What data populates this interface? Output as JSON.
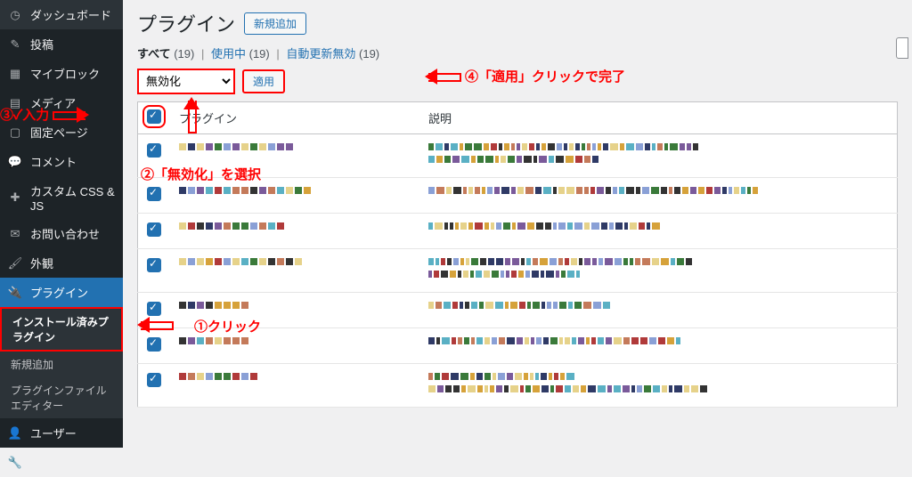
{
  "sidebar": {
    "items": [
      {
        "label": "ダッシュボード",
        "icon": "dashboard"
      },
      {
        "label": "投稿",
        "icon": "pin"
      },
      {
        "label": "マイブロック",
        "icon": "blocks"
      },
      {
        "label": "(hidden)",
        "icon": "repeat"
      },
      {
        "label": "メディア",
        "icon": "media"
      },
      {
        "label": "固定ページ",
        "icon": "page"
      },
      {
        "label": "コメント",
        "icon": "comment"
      },
      {
        "label": "カスタム CSS & JS",
        "icon": "plus"
      },
      {
        "label": "お問い合わせ",
        "icon": "mail"
      },
      {
        "label": "外観",
        "icon": "brush"
      },
      {
        "label": "プラグイン",
        "icon": "plug"
      },
      {
        "label": "ユーザー",
        "icon": "user"
      },
      {
        "label": "ツール",
        "icon": "tools"
      }
    ],
    "sub": [
      {
        "label": "インストール済みプラグイン",
        "active": true,
        "hl": true
      },
      {
        "label": "新規追加"
      },
      {
        "label": "プラグインファイルエディター"
      }
    ]
  },
  "page": {
    "title": "プラグイン",
    "add_new": "新規追加"
  },
  "filters": {
    "all_label": "すべて",
    "all_count": "(19)",
    "active_label": "使用中",
    "active_count": "(19)",
    "auto_label": "自動更新無効",
    "auto_count": "(19)"
  },
  "bulk": {
    "opt": "無効化",
    "apply": "適用"
  },
  "table": {
    "col_plugin": "プラグイン",
    "col_desc": "説明"
  },
  "annotations": {
    "a1": "①クリック",
    "a2": "②「無効化」を選択",
    "a3": "③✓入力",
    "a4": "④「適用」クリックで完了"
  }
}
